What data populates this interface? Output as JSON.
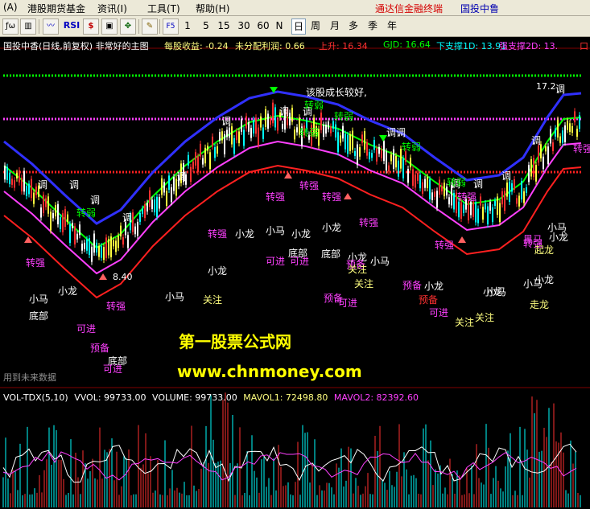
{
  "menubar": {
    "items": [
      "(A)",
      "港股期货基金",
      "资讯(I)",
      "工具(T)",
      "帮助(H)"
    ],
    "right_link": "通达信金融终端",
    "right_title": "国投中鲁"
  },
  "toolbar": {
    "periods": [
      "1",
      "5",
      "15",
      "30",
      "60",
      "N",
      "日",
      "周",
      "月",
      "多",
      "季",
      "年"
    ],
    "selected_period": "日",
    "rsi_label": "RSI",
    "f5_label": "F5"
  },
  "chart_header": {
    "title": "国投中香(日线,前复权) 非常好的主图",
    "eps": "每股收益: -0.24",
    "undist": "未分配利润: 0.66",
    "rise": "上升: 16.34",
    "gjd": "GJD: 16.64",
    "support1": "下支撑1D: 13.91",
    "support2": "强支撑2D: 13.",
    "box": "口"
  },
  "annotations": {
    "good_comment": "该股成长较好,",
    "high_price": "17.2",
    "low_price": "8.40",
    "future_note": "用到未来数据",
    "labels": [
      {
        "t": "调",
        "c": "w"
      },
      {
        "t": "调",
        "c": "w"
      },
      {
        "t": "调",
        "c": "w"
      },
      {
        "t": "调",
        "c": "w"
      },
      {
        "t": "调",
        "c": "w"
      },
      {
        "t": "调",
        "c": "w"
      },
      {
        "t": "调",
        "c": "w"
      },
      {
        "t": "调",
        "c": "w"
      },
      {
        "t": "调调",
        "c": "w"
      },
      {
        "t": "调",
        "c": "w"
      },
      {
        "t": "调",
        "c": "w"
      },
      {
        "t": "调",
        "c": "w"
      },
      {
        "t": "调",
        "c": "w"
      },
      {
        "t": "调",
        "c": "w"
      },
      {
        "t": "转弱",
        "c": "g"
      },
      {
        "t": "转弱",
        "c": "g"
      },
      {
        "t": "转弱",
        "c": "g"
      },
      {
        "t": "转弱",
        "c": "g"
      },
      {
        "t": "转弱",
        "c": "g"
      },
      {
        "t": "转弱",
        "c": "g"
      },
      {
        "t": "转强",
        "c": "m"
      },
      {
        "t": "转强",
        "c": "m"
      },
      {
        "t": "转强",
        "c": "m"
      },
      {
        "t": "转强",
        "c": "m"
      },
      {
        "t": "转强",
        "c": "m"
      },
      {
        "t": "转强",
        "c": "m"
      },
      {
        "t": "转强",
        "c": "m"
      },
      {
        "t": "转强",
        "c": "m"
      },
      {
        "t": "转强",
        "c": "m"
      },
      {
        "t": "转强",
        "c": "m"
      },
      {
        "t": "转强",
        "c": "m"
      },
      {
        "t": "小龙",
        "c": "w"
      },
      {
        "t": "小龙",
        "c": "w"
      },
      {
        "t": "小龙",
        "c": "w"
      },
      {
        "t": "小龙",
        "c": "w"
      },
      {
        "t": "小龙",
        "c": "w"
      },
      {
        "t": "小龙",
        "c": "w"
      },
      {
        "t": "小龙",
        "c": "w"
      },
      {
        "t": "小龙",
        "c": "w"
      },
      {
        "t": "小龙",
        "c": "w"
      },
      {
        "t": "小龙",
        "c": "w"
      },
      {
        "t": "小马",
        "c": "w"
      },
      {
        "t": "小马",
        "c": "w"
      },
      {
        "t": "小马",
        "c": "w"
      },
      {
        "t": "小马",
        "c": "w"
      },
      {
        "t": "小马",
        "c": "w"
      },
      {
        "t": "小马",
        "c": "w"
      },
      {
        "t": "小马",
        "c": "w"
      },
      {
        "t": "底部",
        "c": "w"
      },
      {
        "t": "底部",
        "c": "w"
      },
      {
        "t": "底部",
        "c": "w"
      },
      {
        "t": "底部",
        "c": "w"
      },
      {
        "t": "可进",
        "c": "m"
      },
      {
        "t": "可进",
        "c": "m"
      },
      {
        "t": "可进",
        "c": "m"
      },
      {
        "t": "可进",
        "c": "m"
      },
      {
        "t": "可进",
        "c": "m"
      },
      {
        "t": "可进",
        "c": "m"
      },
      {
        "t": "预备",
        "c": "m"
      },
      {
        "t": "预备",
        "c": "m"
      },
      {
        "t": "预备",
        "c": "m"
      },
      {
        "t": "预备",
        "c": "r"
      },
      {
        "t": "预备",
        "c": "m"
      },
      {
        "t": "关注",
        "c": "y"
      },
      {
        "t": "关注",
        "c": "y"
      },
      {
        "t": "关注",
        "c": "y"
      },
      {
        "t": "关注",
        "c": "y"
      },
      {
        "t": "关注",
        "c": "y"
      },
      {
        "t": "黑马",
        "c": "m"
      },
      {
        "t": "起龙",
        "c": "y"
      },
      {
        "t": "走龙",
        "c": "y"
      }
    ]
  },
  "watermark": {
    "line1": "第一股票公式网",
    "line2": "www.chnmoney.com"
  },
  "volume": {
    "name": "VOL-TDX(5,10)",
    "vvol": "VVOL: 99733.00",
    "volume": "VOLUME: 99733.00",
    "mavol1": "MAVOL1: 72498.80",
    "mavol2": "MAVOL2: 82392.60"
  },
  "colors": {
    "up": "#ff3030",
    "down": "#00ffff",
    "ma_blue": "#3030ff",
    "ma_green": "#00ff00",
    "ma_magenta": "#ff40ff",
    "ma_red": "#ff2020",
    "candle_yellow": "#ffff40"
  }
}
